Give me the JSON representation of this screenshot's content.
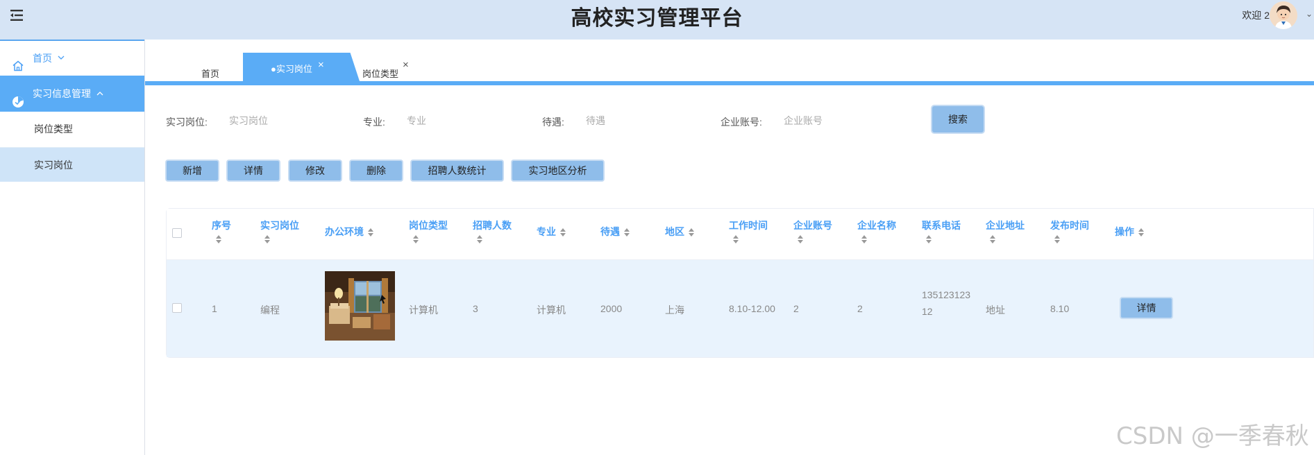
{
  "header": {
    "title": "高校实习管理平台",
    "welcome": "欢迎 2"
  },
  "sidebar": {
    "home_label": "首页",
    "group_label": "实习信息管理",
    "items": [
      {
        "label": "岗位类型"
      },
      {
        "label": "实习岗位"
      }
    ]
  },
  "tabs": {
    "home": "首页",
    "active": "●实习岗位",
    "type": "岗位类型",
    "close_glyph": "×"
  },
  "search": {
    "post_label": "实习岗位:",
    "post_placeholder": "实习岗位",
    "major_label": "专业:",
    "major_placeholder": "专业",
    "pay_label": "待遇:",
    "pay_placeholder": "待遇",
    "account_label": "企业账号:",
    "account_placeholder": "企业账号",
    "button": "搜索"
  },
  "actions": {
    "add": "新增",
    "detail": "详情",
    "edit": "修改",
    "delete": "删除",
    "hire_stats": "招聘人数统计",
    "region_analysis": "实习地区分析"
  },
  "table": {
    "headers": {
      "index": "序号",
      "post": "实习岗位",
      "env": "办公环境",
      "type": "岗位类型",
      "hires": "招聘人数",
      "major": "专业",
      "pay": "待遇",
      "region": "地区",
      "worktime": "工作时间",
      "account": "企业账号",
      "company": "企业名称",
      "phone": "联系电话",
      "address": "企业地址",
      "published": "发布时间",
      "ops": "操作"
    },
    "rows": [
      {
        "index": "1",
        "post": "编程",
        "type": "计算机",
        "hires": "3",
        "major": "计算机",
        "pay": "2000",
        "region": "上海",
        "worktime": "8.10-12.00",
        "account": "2",
        "company": "2",
        "phone_line1": "135123123",
        "phone_line2": "12",
        "address": "地址",
        "published": "8.10",
        "detail_button": "详情"
      }
    ]
  },
  "watermark": "CSDN @一季春秋",
  "colors": {
    "header_bg": "#d6e4f5",
    "accent": "#5aacf6",
    "button_bg": "#8fbdea",
    "table_header_text": "#4a9ff5",
    "row_bg": "#e9f3fd"
  },
  "icons": [
    "menu-icon",
    "home-icon",
    "pie-chart-icon",
    "chevron-down-icon",
    "chevron-up-icon",
    "close-icon",
    "sort-icon",
    "avatar"
  ]
}
